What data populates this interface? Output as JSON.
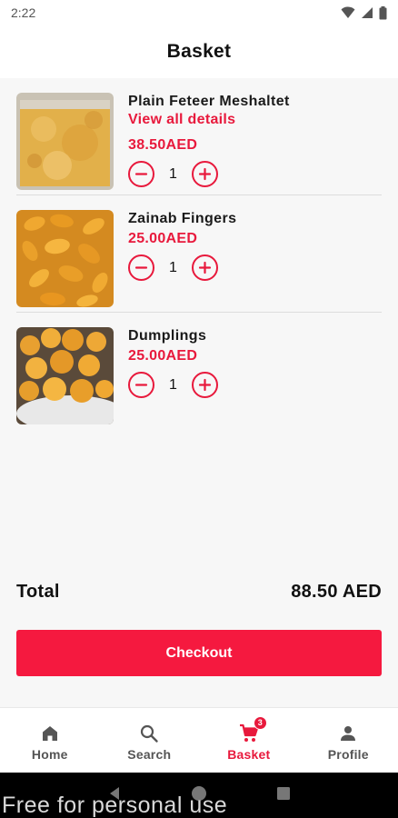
{
  "status_bar": {
    "time": "2:22",
    "icons": [
      "wifi-icon",
      "signal-icon",
      "battery-icon"
    ]
  },
  "header": {
    "title": "Basket"
  },
  "items": [
    {
      "name": "Plain Feteer Meshaltet",
      "details_link": "View all details",
      "price": "38.50AED",
      "quantity": "1",
      "image": "feteer-photo"
    },
    {
      "name": "Zainab Fingers",
      "price": "25.00AED",
      "quantity": "1",
      "image": "zainab-fingers-photo"
    },
    {
      "name": "Dumplings",
      "price": "25.00AED",
      "quantity": "1",
      "image": "dumplings-photo"
    }
  ],
  "summary": {
    "total_label": "Total",
    "total_value": "88.50 AED",
    "checkout_label": "Checkout"
  },
  "bottom_nav": {
    "items": [
      {
        "label": "Home",
        "icon": "home-icon"
      },
      {
        "label": "Search",
        "icon": "search-icon"
      },
      {
        "label": "Basket",
        "icon": "cart-icon",
        "badge": "3",
        "active": true
      },
      {
        "label": "Profile",
        "icon": "person-icon"
      }
    ]
  },
  "watermark": "Free for personal use",
  "colors": {
    "accent": "#e8193c",
    "checkout": "#f5193f",
    "background": "#f7f7f7"
  }
}
